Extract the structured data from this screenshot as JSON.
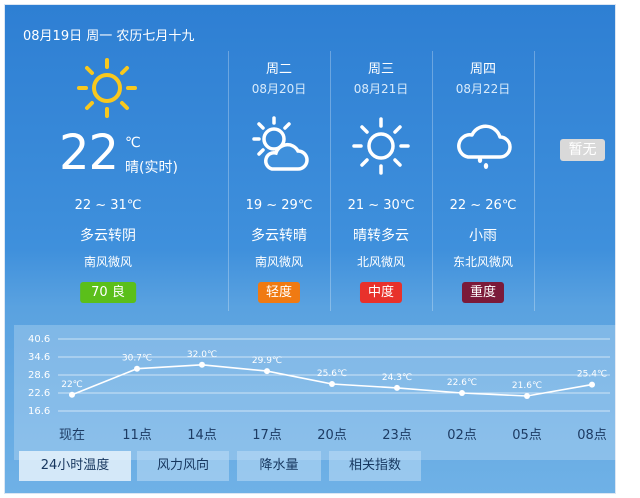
{
  "header": {
    "date_line": "08月19日 周一 农历七月十九"
  },
  "today": {
    "icon": "sun-icon",
    "temp": "22",
    "unit": "℃",
    "now_label": "晴(实时)",
    "range": "22 ~ 31℃",
    "condition": "多云转阴",
    "wind": "南风微风",
    "aqi": "70 良",
    "aqi_color": "#5bbf1a"
  },
  "days": [
    {
      "weekday": "周二",
      "date": "08月20日",
      "icon": "partly-cloudy-icon",
      "range": "19 ~ 29℃",
      "condition": "多云转晴",
      "wind": "南风微风",
      "aqi": "轻度",
      "aqi_color": "#f07a12"
    },
    {
      "weekday": "周三",
      "date": "08月21日",
      "icon": "sun-icon",
      "range": "21 ~ 30℃",
      "condition": "晴转多云",
      "wind": "北风微风",
      "aqi": "中度",
      "aqi_color": "#e8312b"
    },
    {
      "weekday": "周四",
      "date": "08月22日",
      "icon": "rain-cloud-icon",
      "range": "22 ~ 26℃",
      "condition": "小雨",
      "wind": "东北风微风",
      "aqi": "重度",
      "aqi_color": "#7b1a3a"
    }
  ],
  "no_data_label": "暂无",
  "chart_data": {
    "type": "line",
    "title": "",
    "x": [
      "现在",
      "11点",
      "14点",
      "17点",
      "20点",
      "23点",
      "02点",
      "05点",
      "08点"
    ],
    "y_ticks": [
      "40.6",
      "34.6",
      "28.6",
      "22.6",
      "16.6"
    ],
    "ylim": [
      16.6,
      40.6
    ],
    "series": [
      {
        "values": [
          22,
          30.7,
          32.0,
          29.9,
          25.6,
          24.3,
          22.6,
          21.6,
          25.4
        ],
        "labels": [
          "22℃",
          "30.7℃",
          "32.0℃",
          "29.9℃",
          "25.6℃",
          "24.3℃",
          "22.6℃",
          "21.6℃",
          "25.4℃"
        ]
      }
    ],
    "grid": true
  },
  "tabs": [
    {
      "label": "24小时温度",
      "active": true
    },
    {
      "label": "风力风向",
      "active": false
    },
    {
      "label": "降水量",
      "active": false
    },
    {
      "label": "相关指数",
      "active": false
    }
  ]
}
